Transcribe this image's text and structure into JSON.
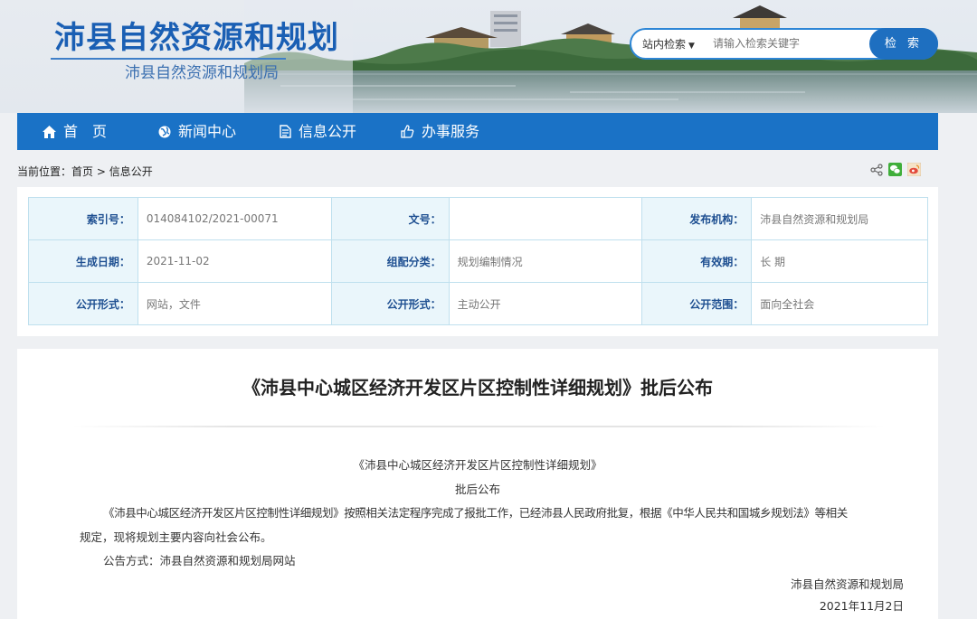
{
  "header": {
    "site_title": "沛县自然资源和规划",
    "site_subtitle": "沛县自然资源和规划局",
    "search": {
      "scope": "站内检索",
      "placeholder": "请输入检索关键字",
      "button": "检 索"
    }
  },
  "nav": {
    "items": [
      {
        "label": "首　页",
        "icon": "home-icon"
      },
      {
        "label": "新闻中心",
        "icon": "globe-icon"
      },
      {
        "label": "信息公开",
        "icon": "document-icon"
      },
      {
        "label": "办事服务",
        "icon": "thumbs-up-icon"
      }
    ]
  },
  "breadcrumb": {
    "prefix": "当前位置：",
    "home": "首页",
    "separator": ">",
    "current": "信息公开"
  },
  "share": {
    "icons": [
      "share-icon",
      "wechat-icon",
      "weibo-icon"
    ]
  },
  "info_table": {
    "rows": [
      [
        {
          "label": "索引号：",
          "value": "014084102/2021-00071"
        },
        {
          "label": "文号：",
          "value": ""
        },
        {
          "label": "发布机构：",
          "value": "沛县自然资源和规划局"
        }
      ],
      [
        {
          "label": "生成日期：",
          "value": "2021-11-02"
        },
        {
          "label": "组配分类：",
          "value": "规划编制情况"
        },
        {
          "label": "有效期：",
          "value": "长 期"
        }
      ],
      [
        {
          "label": "公开形式：",
          "value": "网站，文件"
        },
        {
          "label": "公开形式：",
          "value": "主动公开"
        },
        {
          "label": "公开范围：",
          "value": "面向全社会"
        }
      ]
    ]
  },
  "article": {
    "title": "《沛县中心城区经济开发区片区控制性详细规划》批后公布",
    "para_heading": "《沛县中心城区经济开发区片区控制性详细规划》",
    "para_subheading": "批后公布",
    "para_body_1": "《沛县中心城区经济开发区片区控制性详细规划》按照相关法定程序完成了报批工作，已经沛县人民政府批复，根据《中华人民共和国城乡规划法》等相关",
    "para_body_2": "规定，现将规划主要内容向社会公布。",
    "para_method": "公告方式：沛县自然资源和规划局网站",
    "signature": "沛县自然资源和规划局",
    "date": "2021年11月2日"
  },
  "colors": {
    "nav_bg": "#1a72c6",
    "title_blue": "#1a5fb4",
    "table_label_bg": "#eaf6fb",
    "table_border": "#bfe0ee"
  }
}
